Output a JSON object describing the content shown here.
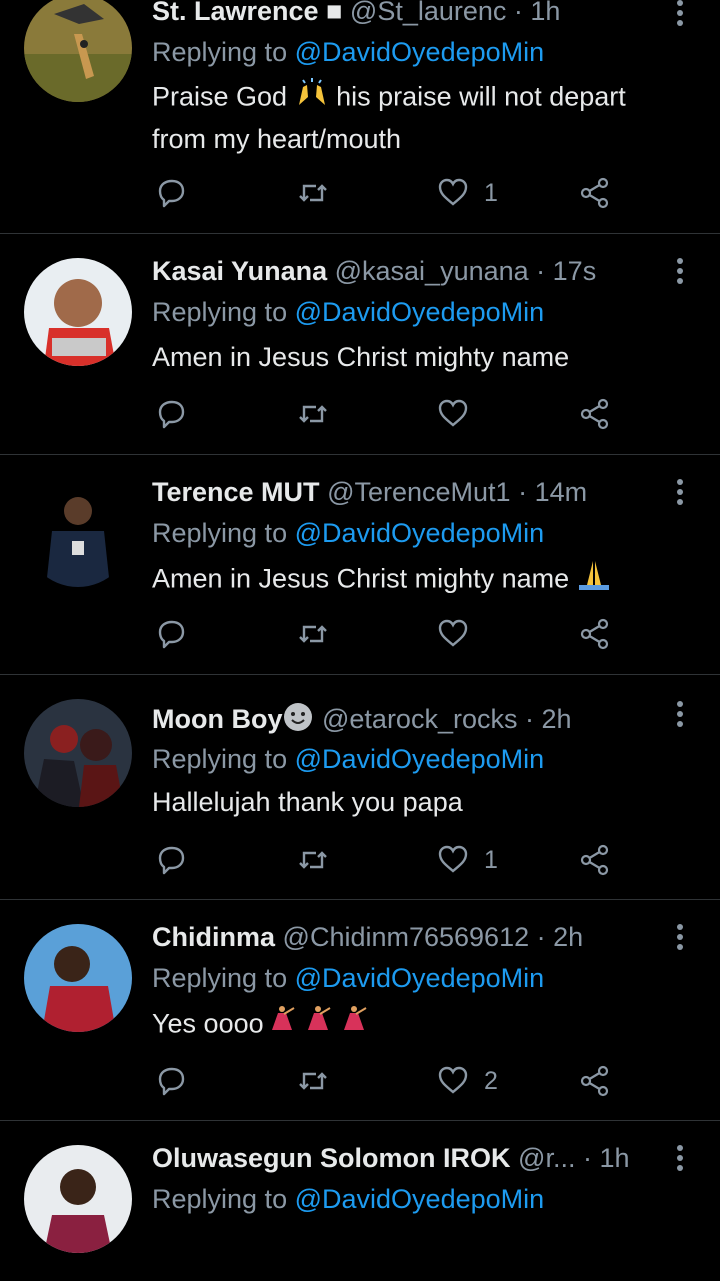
{
  "tweets": [
    {
      "name": "St. Lawrence",
      "badge": "■",
      "handle": "@St_laurenc",
      "time": "· 1h",
      "reply_prefix": "Replying to",
      "reply_to": "@DavidOyedepoMin",
      "text_line1": "Praise God",
      "text_line1_after": "his praise will not depart",
      "text_line2": "from my heart/mouth",
      "emoji": "raising-hands",
      "likes": "1"
    },
    {
      "name": "Kasai Yunana",
      "handle": "@kasai_yunana",
      "time": "· 17s",
      "reply_prefix": "Replying to",
      "reply_to": "@DavidOyedepoMin",
      "text": "Amen in Jesus Christ mighty name",
      "likes": ""
    },
    {
      "name": "Terence MUT",
      "handle": "@TerenceMut1",
      "time": "· 14m",
      "reply_prefix": "Replying to",
      "reply_to": "@DavidOyedepoMin",
      "text": "Amen in Jesus Christ mighty name",
      "emoji": "folded-hands",
      "likes": ""
    },
    {
      "name": "Moon Boy",
      "handle": "@etarock_rocks",
      "time": "· 2h",
      "reply_prefix": "Replying to",
      "reply_to": "@DavidOyedepoMin",
      "text": "Hallelujah thank you papa",
      "emoji": "smiley-face",
      "likes": "1"
    },
    {
      "name": "Chidinma",
      "handle": "@Chidinm76569612",
      "time": "· 2h",
      "reply_prefix": "Replying to",
      "reply_to": "@DavidOyedepoMin",
      "text": "Yes oooo",
      "emoji": "dancer",
      "likes": "2"
    },
    {
      "name": "Oluwasegun Solomon IROK",
      "handle": "@r...",
      "time": "· 1h",
      "reply_prefix": "Replying to",
      "reply_to": "@DavidOyedepoMin",
      "likes": ""
    }
  ],
  "colors": {
    "background": "#000000",
    "muted": "#8b98a5",
    "link": "#1d9bf0",
    "text": "#e7e9ea",
    "divider": "#2f3336"
  }
}
